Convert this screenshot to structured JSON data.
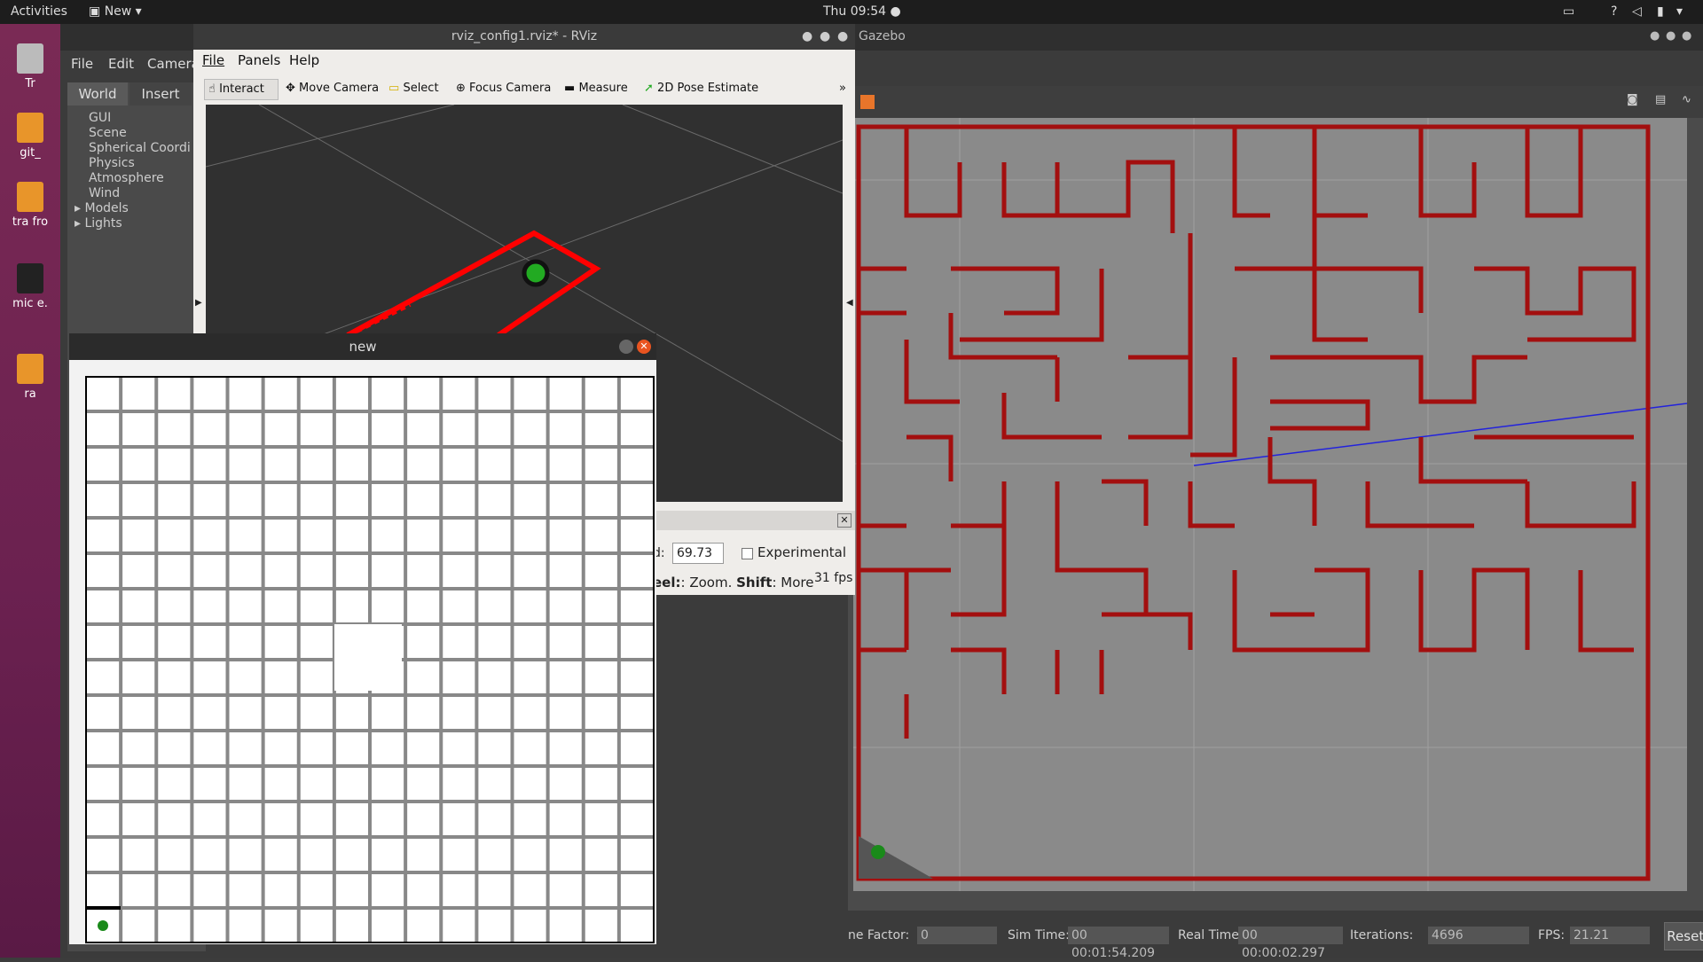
{
  "topbar": {
    "activities": "Activities",
    "app_menu": "New",
    "clock": "Thu 09:54"
  },
  "desktop": {
    "icons": [
      "Tr",
      "git_",
      "tra fro",
      "mic e.",
      "ra"
    ]
  },
  "gazebo": {
    "title": "Gazebo",
    "menu": [
      "File",
      "Edit",
      "Camera"
    ],
    "tabs": [
      "World",
      "Insert"
    ],
    "tree": [
      "GUI",
      "Scene",
      "Spherical Coordi",
      "Physics",
      "Atmosphere",
      "Wind",
      "Models",
      "Lights"
    ],
    "status": {
      "factor_label": "ne Factor:",
      "factor_value": "0",
      "sim_time_label": "Sim Time:",
      "sim_time_value": "00 00:01:54.209",
      "real_time_label": "Real Time:",
      "real_time_value": "00 00:00:02.297",
      "iterations_label": "Iterations:",
      "iterations_value": "4696",
      "fps_label": "FPS:",
      "fps_value": "21.21",
      "reset_label": "Reset Time"
    },
    "colors": {
      "wall": "#a30f0f",
      "floor": "#8a8a8a",
      "robot": "#1a8a1a"
    }
  },
  "rviz": {
    "title": "rviz_config1.rviz* - RViz",
    "menu": [
      "File",
      "Panels",
      "Help"
    ],
    "tools": [
      "Interact",
      "Move Camera",
      "Select",
      "Focus Camera",
      "Measure",
      "2D Pose Estimate"
    ],
    "more": "»",
    "bottom": {
      "field_label": "d:",
      "field_value": "69.73",
      "experimental": "Experimental",
      "hint_prefix": "eel:",
      "hint_zoom": ": Zoom.",
      "hint_shift": "Shift",
      "hint_more": ": More",
      "fps": "31 fps"
    },
    "colors": {
      "path": "#ff0000",
      "robot": "#22aa22"
    }
  },
  "newwin": {
    "title": "new",
    "grid_cols": 16,
    "grid_rows": 16
  }
}
